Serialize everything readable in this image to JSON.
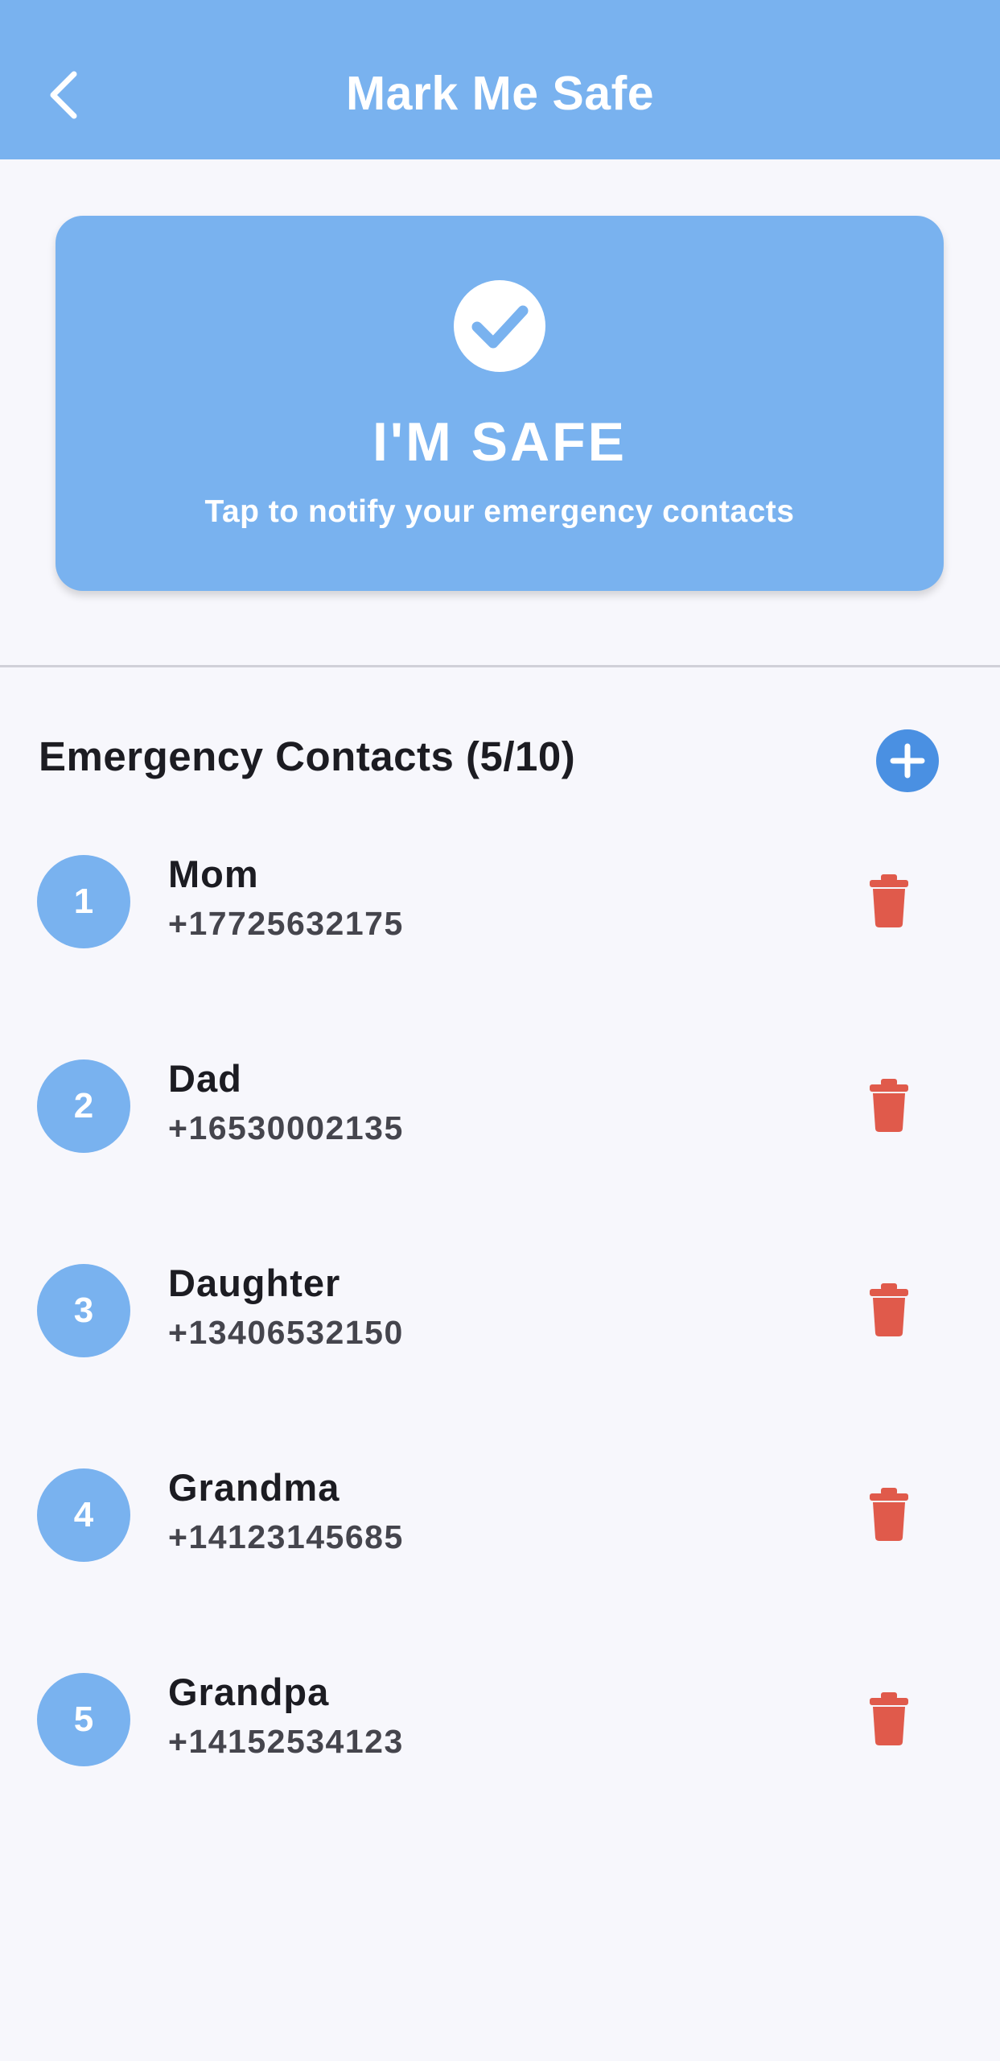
{
  "header": {
    "title": "Mark Me Safe",
    "back_icon": "chevron-left-icon",
    "background": "#79B2EF"
  },
  "safe_card": {
    "title": "I'M SAFE",
    "subtitle": "Tap to notify your emergency contacts",
    "icon": "check-circle-icon",
    "background": "#79B2EF"
  },
  "contacts": {
    "heading": "Emergency Contacts (5/10)",
    "add_icon": "plus-circle-icon",
    "delete_icon": "trash-icon",
    "delete_color": "#E05A4B",
    "items": [
      {
        "number": "1",
        "name": "Mom",
        "phone": "+17725632175"
      },
      {
        "number": "2",
        "name": "Dad",
        "phone": "+16530002135"
      },
      {
        "number": "3",
        "name": "Daughter",
        "phone": "+13406532150"
      },
      {
        "number": "4",
        "name": "Grandma",
        "phone": "+14123145685"
      },
      {
        "number": "5",
        "name": "Grandpa",
        "phone": "+14152534123"
      }
    ]
  }
}
